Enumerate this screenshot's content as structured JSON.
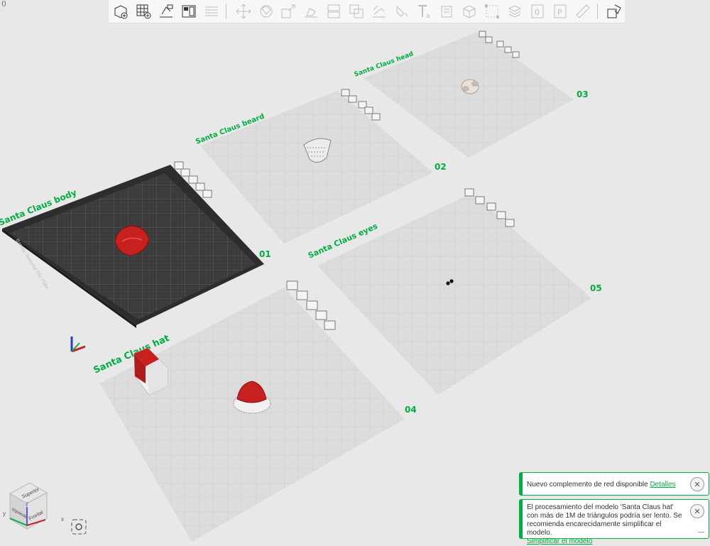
{
  "toolbar": {
    "items": [
      "add-object",
      "add-plate",
      "auto-orient",
      "arrange",
      "slice-all-plates",
      "move",
      "rotate",
      "scale",
      "lay-on-face",
      "cut",
      "boolean",
      "support-paint",
      "seam-paint",
      "text",
      "height-range",
      "assembly",
      "measure",
      "split",
      "variable-layer",
      "wipe-tower",
      "prime-tower",
      "ruler",
      "assembly-view"
    ],
    "collapse_label": "⟨⟩"
  },
  "plates": [
    {
      "name": "Santa Claus body",
      "number": "01"
    },
    {
      "name": "Santa Claus beard",
      "number": "02"
    },
    {
      "name": "Santa Claus head",
      "number": "03"
    },
    {
      "name": "Santa Claus hat",
      "number": "04"
    },
    {
      "name": "Santa Claus eyes",
      "number": "05"
    }
  ],
  "bed_label": "Bambu Textured PEI Plate",
  "view_cube": {
    "top": "Superior",
    "front": "Frontal",
    "left": "Izquierda"
  },
  "axes": {
    "x": "x",
    "y": "y",
    "z": "z"
  },
  "notifications": [
    {
      "text": "Nuevo complemento de red disponible",
      "link": "Detalles"
    },
    {
      "text": "El procesamiento del modelo 'Santa Claus hat' con más de 1M de triángulos podría ser lento. Se recomienda encarecidamente simplificar el modelo.",
      "link": "Simplificar el modelo"
    }
  ],
  "colors": {
    "accent": "#00ae42",
    "plate": "#dcdcdc",
    "bed": "#3b3b3b",
    "model_red": "#c8201e"
  }
}
